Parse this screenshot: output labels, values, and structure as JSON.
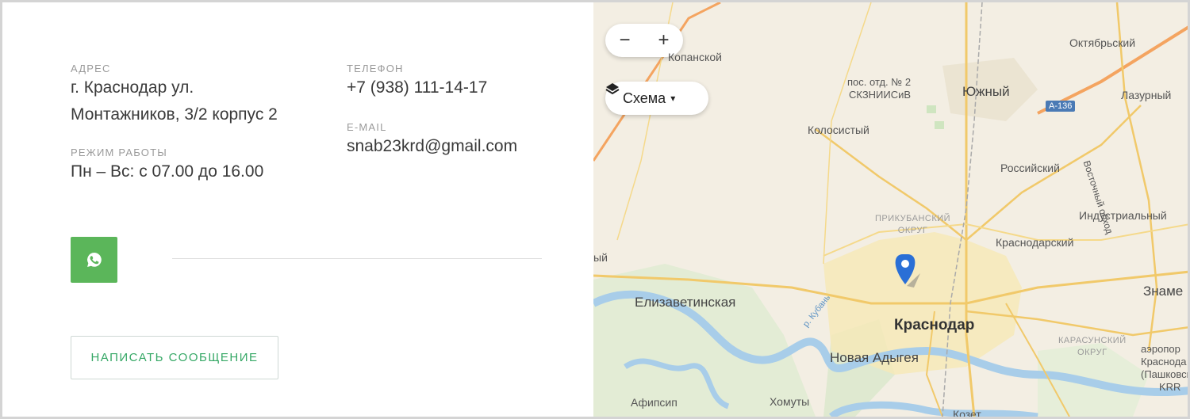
{
  "contacts": {
    "address_label": "АДРЕС",
    "address_line1": "г. Краснодар ул.",
    "address_line2": "Монтажников, 3/2 корпус 2",
    "hours_label": "РЕЖИМ РАБОТЫ",
    "hours_value": "Пн – Вс: с 07.00 до 16.00",
    "phone_label": "ТЕЛЕФОН",
    "phone_value": "+7 (938) 111-14-17",
    "email_label": "E-MAIL",
    "email_value": "snab23krd@gmail.com",
    "whatsapp_icon": "whatsapp-icon",
    "message_button": "НАПИСАТЬ СООБЩЕНИЕ",
    "accent_color": "#5bb65a",
    "button_text_color": "#36a866"
  },
  "map": {
    "zoom_out": "−",
    "zoom_in": "+",
    "layers_label": "Схема",
    "layers_arrow": "▾",
    "places": {
      "kopanskoy": "Копанской",
      "pos_otd": "пос. отд. № 2",
      "skzniisiv": "СКЗНИИСиВ",
      "yuzhny": "Южный",
      "oktyabrsky": "Октябрьский",
      "lazurny": "Лазурный",
      "a136": "А-136",
      "kolosisty": "Колосистый",
      "rossiysky": "Российский",
      "vostochny_obhod": "Восточный обход",
      "prikubansky1": "ПРИКУБАНСКИЙ",
      "prikubansky2": "ОКРУГ",
      "industrialny": "Индустриальный",
      "krasnodarsky": "Краснодарский",
      "left_edge": "ый",
      "znamensky": "Знаме",
      "elizavetinskaya": "Елизаветинская",
      "river_kuban": "р. Кубань",
      "krasnodar": "Краснодар",
      "karasunsky1": "КАРАСУНСКИЙ",
      "karasunsky2": "ОКРУГ",
      "nova_adygeya": "Новая Адыгея",
      "airport1": "аэропор",
      "airport2": "Краснода",
      "airport3": "(Пашковск",
      "airport4": "KRR",
      "afipsip": "Афипсип",
      "khomuty": "Хомуты",
      "kozet": "Козет"
    }
  }
}
